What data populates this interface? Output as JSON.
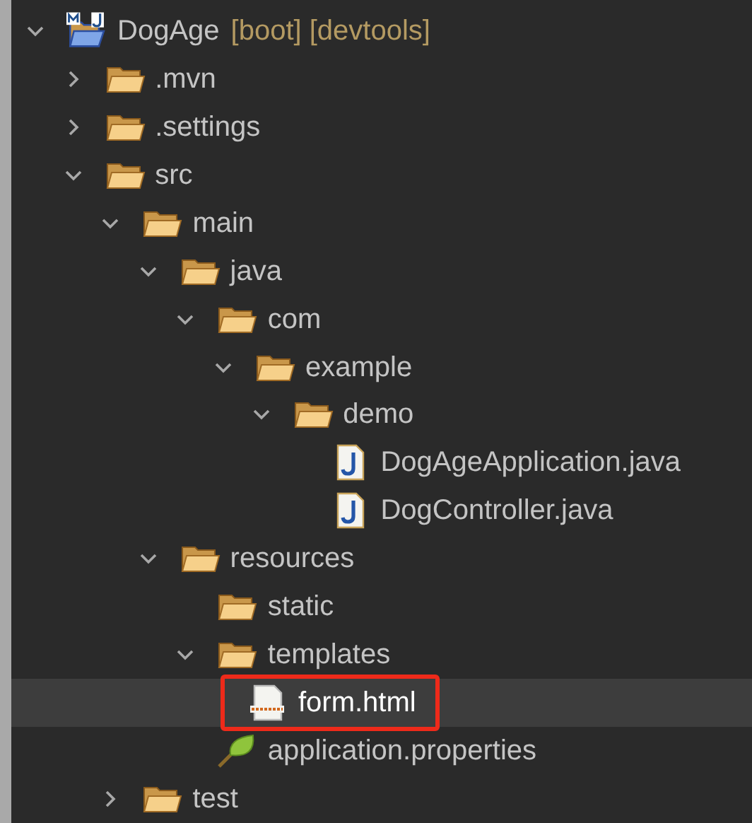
{
  "tree": [
    {
      "kind": "project",
      "label": "DogAge",
      "decoration": "[boot] [devtools]",
      "expanded": true,
      "selected": false,
      "children": [
        {
          "kind": "folder",
          "label": ".mvn",
          "expanded": false,
          "selected": false
        },
        {
          "kind": "folder",
          "label": ".settings",
          "expanded": false,
          "selected": false
        },
        {
          "kind": "folder",
          "label": "src",
          "expanded": true,
          "selected": false,
          "children": [
            {
              "kind": "folder",
              "label": "main",
              "expanded": true,
              "selected": false,
              "children": [
                {
                  "kind": "folder",
                  "label": "java",
                  "expanded": true,
                  "selected": false,
                  "children": [
                    {
                      "kind": "folder",
                      "label": "com",
                      "expanded": true,
                      "selected": false,
                      "children": [
                        {
                          "kind": "folder",
                          "label": "example",
                          "expanded": true,
                          "selected": false,
                          "children": [
                            {
                              "kind": "folder",
                              "label": "demo",
                              "expanded": true,
                              "selected": false,
                              "children": [
                                {
                                  "kind": "java",
                                  "label": "DogAgeApplication.java",
                                  "selected": false
                                },
                                {
                                  "kind": "java",
                                  "label": "DogController.java",
                                  "selected": false
                                }
                              ]
                            }
                          ]
                        }
                      ]
                    }
                  ]
                },
                {
                  "kind": "folder",
                  "label": "resources",
                  "expanded": true,
                  "selected": false,
                  "children": [
                    {
                      "kind": "folder",
                      "label": "static",
                      "selected": false
                    },
                    {
                      "kind": "folder",
                      "label": "templates",
                      "expanded": true,
                      "selected": false,
                      "children": [
                        {
                          "kind": "html",
                          "label": "form.html",
                          "selected": true,
                          "highlighted": true
                        }
                      ]
                    },
                    {
                      "kind": "properties",
                      "label": "application.properties",
                      "selected": false
                    }
                  ]
                }
              ]
            },
            {
              "kind": "folder",
              "label": "test",
              "expanded": false,
              "selected": false
            }
          ]
        }
      ]
    }
  ]
}
